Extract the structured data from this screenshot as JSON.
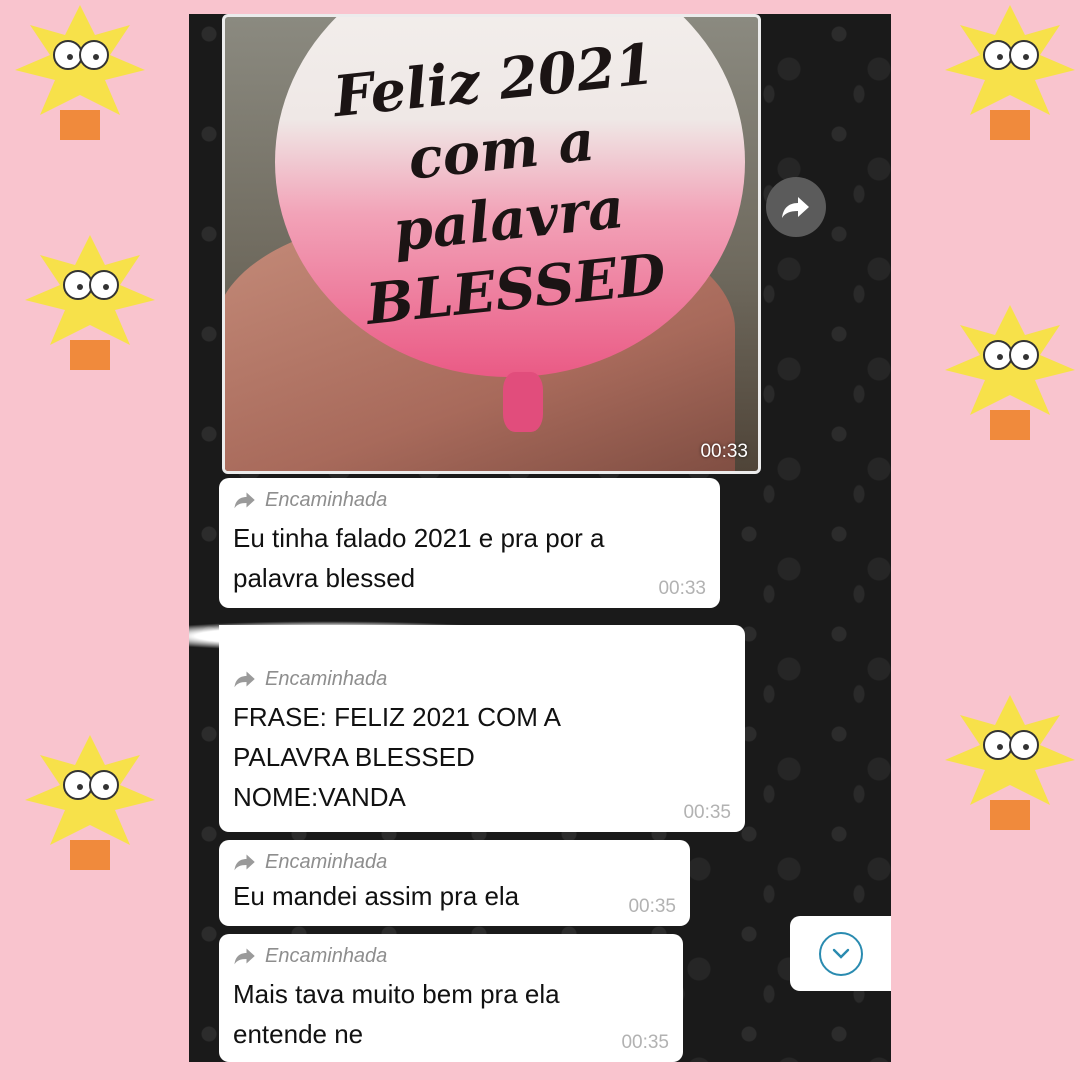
{
  "colors": {
    "page_background": "#f9c4ce",
    "chat_background": "#1a1a1a",
    "bubble": "#ffffff",
    "forwarded_label": "#8e8e8e",
    "timestamp": "#b2b2b2",
    "scroll_button_accent": "#2a8bb0"
  },
  "media": {
    "image_text_line1": "Feliz 2021 com a",
    "image_text_line2": "palavra BLESSED",
    "duration": "00:33",
    "forward_icon": "forward-arrow-icon"
  },
  "messages": [
    {
      "forwarded_label": "Encaminhada",
      "lines": [
        "Eu tinha falado 2021 e pra por a",
        "palavra blessed"
      ],
      "time": "00:33"
    },
    {
      "forwarded_label": "Encaminhada",
      "lines": [
        "FRASE: FELIZ 2021 COM A",
        "PALAVRA BLESSED",
        "NOME:VANDA"
      ],
      "time": "00:35"
    },
    {
      "forwarded_label": "Encaminhada",
      "lines": [
        "Eu mandei assim pra ela"
      ],
      "time": "00:35"
    },
    {
      "forwarded_label": "Encaminhada",
      "lines": [
        "Mais tava muito bem pra ela",
        "entende ne"
      ],
      "time": "00:35"
    }
  ],
  "scroll_button_icon": "chevron-down-icon"
}
